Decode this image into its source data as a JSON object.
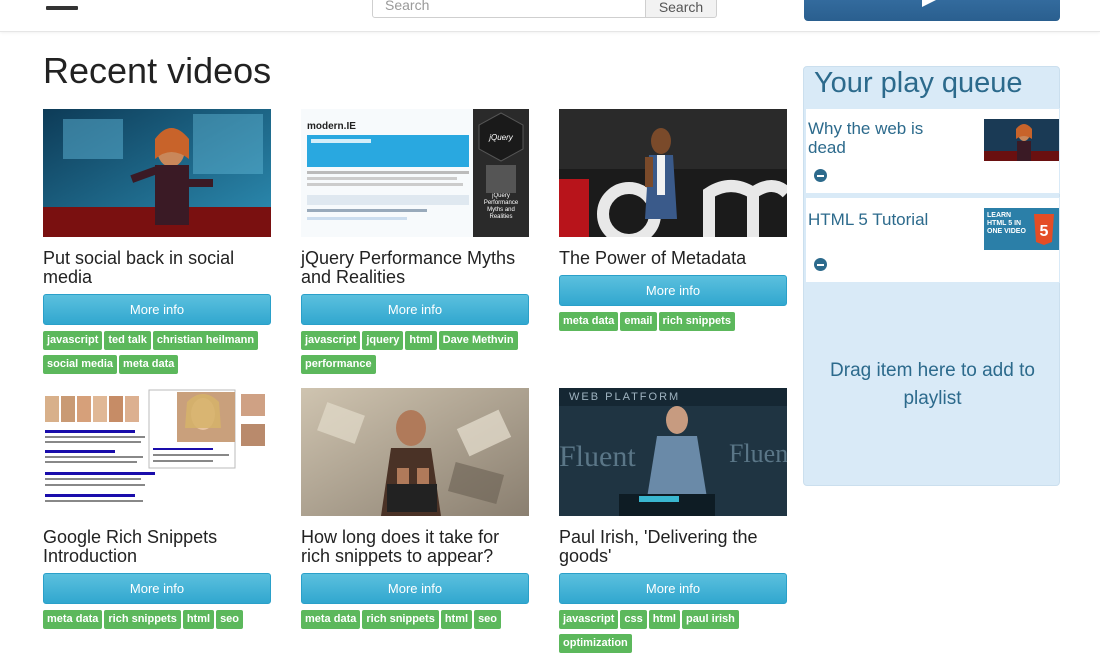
{
  "search": {
    "placeholder": "Search",
    "button_label": "Search"
  },
  "page_title": "Recent videos",
  "videos": [
    {
      "title": "Put social back in social media",
      "more_label": "More info",
      "tags": [
        "javascript",
        "ted talk",
        "christian heilmann",
        "social media",
        "meta data"
      ]
    },
    {
      "title": "jQuery Performance Myths and Realities",
      "more_label": "More info",
      "tags": [
        "javascript",
        "jquery",
        "html",
        "Dave Methvin",
        "performance"
      ]
    },
    {
      "title": "The Power of Metadata",
      "more_label": "More info",
      "tags": [
        "meta data",
        "email",
        "rich snippets"
      ]
    },
    {
      "title": "Google Rich Snippets Introduction",
      "more_label": "More info",
      "tags": [
        "meta data",
        "rich snippets",
        "html",
        "seo"
      ]
    },
    {
      "title": "How long does it take for rich snippets to appear?",
      "more_label": "More info",
      "tags": [
        "meta data",
        "rich snippets",
        "html",
        "seo"
      ]
    },
    {
      "title": "Paul Irish, 'Delivering the goods'",
      "more_label": "More info",
      "tags": [
        "javascript",
        "css",
        "html",
        "paul irish",
        "optimization"
      ]
    }
  ],
  "thumb_text": {
    "modernie": "modern.IE",
    "jquery_logo": "jQuery",
    "jquery_caption": "jQuery Performance Myths and Realities",
    "web_platform": "WEB PLATFORM",
    "fluent": "Fluent",
    "html5_badge": "LEARN HTML 5 IN ONE VIDEO",
    "html5_logo": "5"
  },
  "queue": {
    "title": "Your play queue",
    "items": [
      {
        "title": "Why the web is dead"
      },
      {
        "title": "HTML 5 Tutorial"
      }
    ],
    "drop_hint": "Drag item here to add to playlist"
  },
  "colors": {
    "tag_green": "#5cb85c",
    "button_blue": "#5bc0de",
    "queue_bg": "#d9eaf7",
    "queue_text": "#2c6a8c"
  }
}
